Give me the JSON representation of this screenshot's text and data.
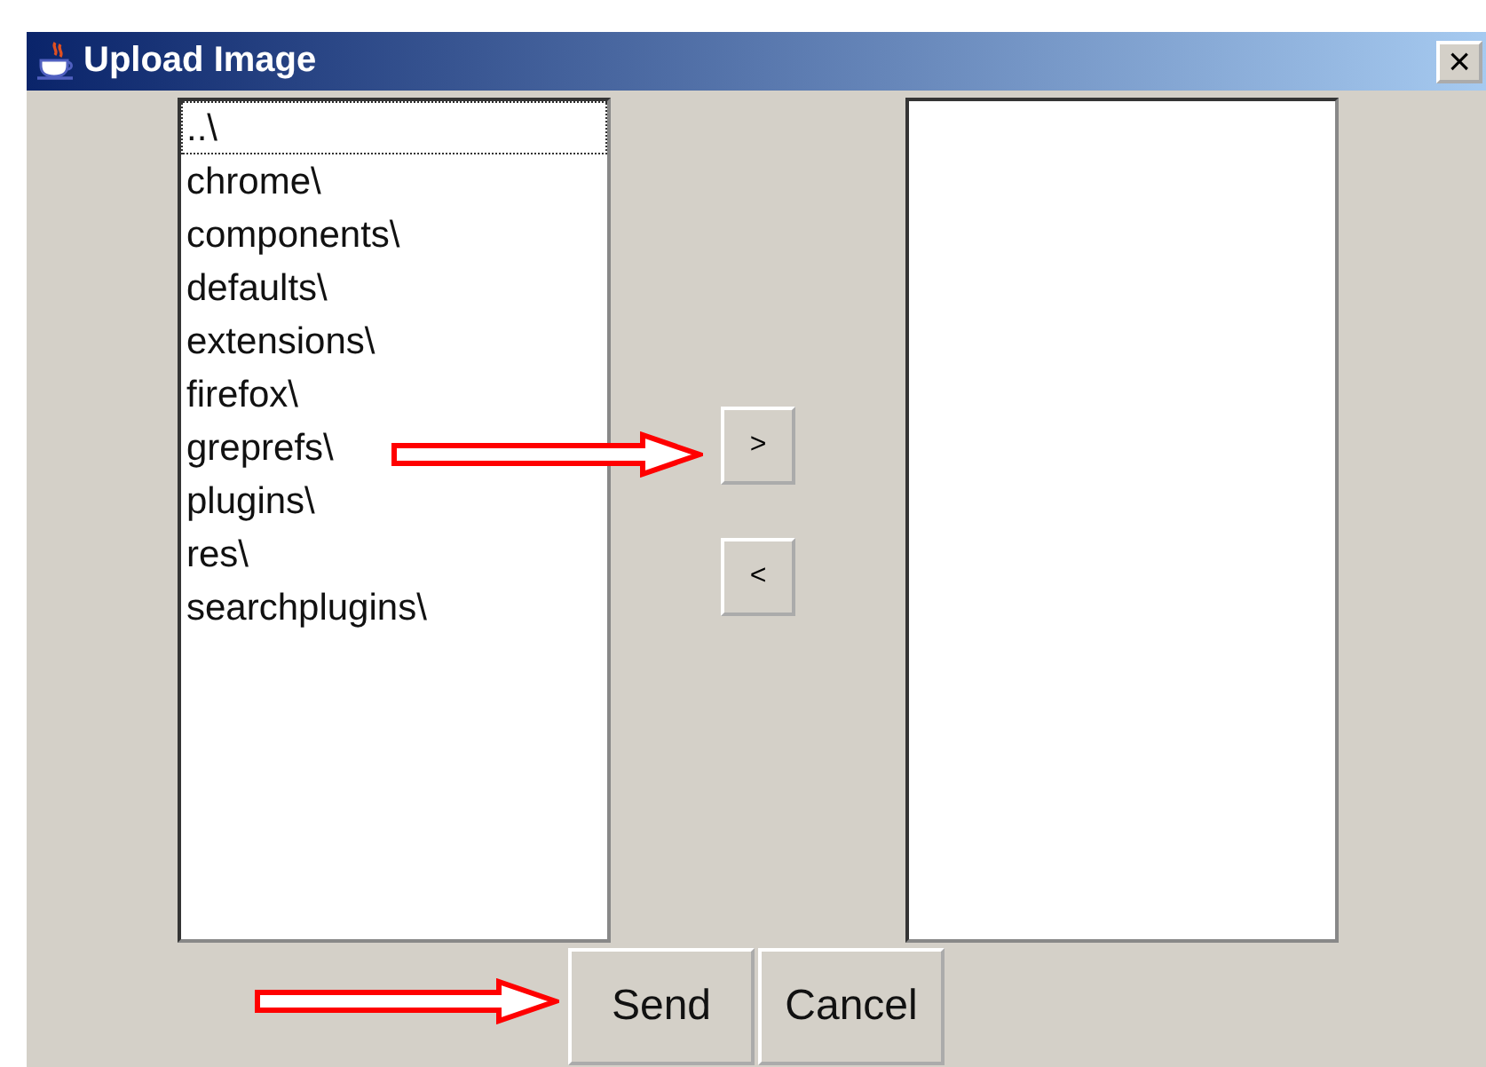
{
  "window": {
    "title": "Upload Image",
    "close_label": "×"
  },
  "source_list": {
    "items": [
      {
        "label": "..\\",
        "selected": true
      },
      {
        "label": "chrome\\",
        "selected": false
      },
      {
        "label": "components\\",
        "selected": false
      },
      {
        "label": "defaults\\",
        "selected": false
      },
      {
        "label": "extensions\\",
        "selected": false
      },
      {
        "label": "firefox\\",
        "selected": false
      },
      {
        "label": "greprefs\\",
        "selected": false
      },
      {
        "label": "plugins\\",
        "selected": false
      },
      {
        "label": "res\\",
        "selected": false
      },
      {
        "label": "searchplugins\\",
        "selected": false
      }
    ]
  },
  "move_buttons": [
    {
      "label": ">"
    },
    {
      "label": "<"
    }
  ],
  "buttons": [
    {
      "label": "Send"
    },
    {
      "label": "Cancel"
    }
  ]
}
